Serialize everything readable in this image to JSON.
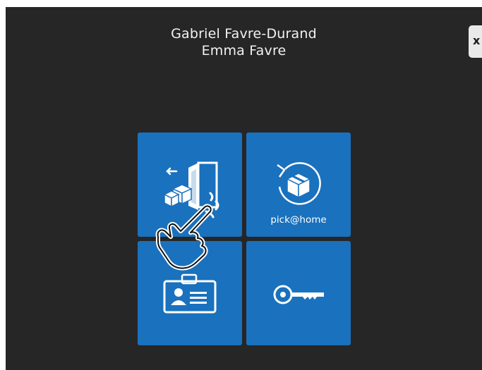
{
  "header": {
    "name_line1": "Gabriel Favre-Durand",
    "name_line2": "Emma Favre"
  },
  "close_button": {
    "icon": "close-icon",
    "label": "x"
  },
  "tiles": [
    {
      "id": "deposit",
      "icon": "parcel-door-icon",
      "label": ""
    },
    {
      "id": "pickathome",
      "icon": "parcel-return-icon",
      "label": "pick@home"
    },
    {
      "id": "badge",
      "icon": "id-badge-icon",
      "label": ""
    },
    {
      "id": "key",
      "icon": "key-icon",
      "label": ""
    }
  ],
  "overlay": {
    "icon": "tap-hand-icon"
  },
  "colors": {
    "background": "#262626",
    "tile": "#1a71bd",
    "icon": "#ffffff"
  }
}
